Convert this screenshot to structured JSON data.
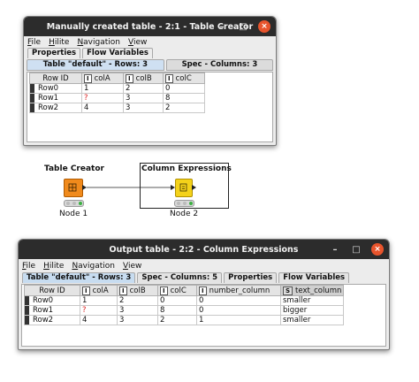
{
  "window1": {
    "title": "Manually created table - 2:1 - Table Creator",
    "menu": [
      "File",
      "Hilite",
      "Navigation",
      "View"
    ],
    "tabs": [
      "Properties",
      "Flow Variables"
    ],
    "subtabs": [
      "Table \"default\" - Rows: 3",
      "Spec - Columns: 3"
    ],
    "table": {
      "headers": [
        "Row ID",
        "colA",
        "colB",
        "colC"
      ],
      "type_badges": [
        "I",
        "I",
        "I"
      ],
      "rows": [
        [
          "Row0",
          "1",
          "2",
          "0"
        ],
        [
          "Row1",
          "?",
          "3",
          "8"
        ],
        [
          "Row2",
          "4",
          "3",
          "2"
        ]
      ]
    }
  },
  "workflow": {
    "node1": {
      "name": "Table Creator",
      "caption": "Node 1"
    },
    "node2": {
      "name": "Column Expressions",
      "caption": "Node 2"
    }
  },
  "window2": {
    "title": "Output table - 2:2 - Column Expressions",
    "menu": [
      "File",
      "Hilite",
      "Navigation",
      "View"
    ],
    "tabs": [
      "Table \"default\" - Rows: 3",
      "Spec - Columns: 5",
      "Properties",
      "Flow Variables"
    ],
    "table": {
      "headers": [
        "Row ID",
        "colA",
        "colB",
        "colC",
        "number_column",
        "text_column"
      ],
      "type_badges": [
        "I",
        "I",
        "I",
        "I",
        "S"
      ],
      "rows": [
        [
          "Row0",
          "1",
          "2",
          "0",
          "0",
          "smaller"
        ],
        [
          "Row1",
          "?",
          "3",
          "8",
          "0",
          "bigger"
        ],
        [
          "Row2",
          "4",
          "3",
          "2",
          "1",
          "smaller"
        ]
      ]
    }
  },
  "window_controls": {
    "minimize": "–",
    "maximize": "□",
    "close": "×"
  },
  "colors": {
    "titlebar": "#2c2c2c",
    "close_button": "#e8542c",
    "node1_orange": "#f08a1c",
    "node2_yellow": "#f4d21a",
    "selected_tab": "#c7dcf0"
  }
}
